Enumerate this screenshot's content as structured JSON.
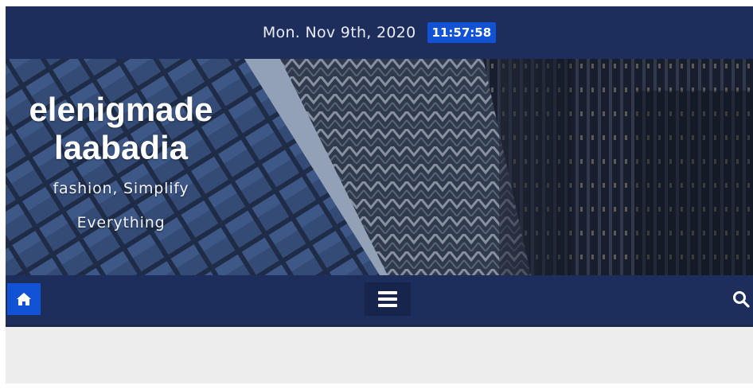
{
  "header": {
    "date": "Mon. Nov 9th, 2020",
    "time": "11:57:58"
  },
  "branding": {
    "site_title_line1": "elenigmade",
    "site_title_line2": "laabadia",
    "tagline_line1": "fashion, Simplify",
    "tagline_line2": "Everything"
  },
  "navbar": {
    "home_icon": "home-icon",
    "menu_icon": "hamburger-menu-icon",
    "search_icon": "search-icon"
  },
  "colors": {
    "navy": "#1e2e5c",
    "accent_blue": "#1253d6",
    "page_background": "#ededed"
  }
}
